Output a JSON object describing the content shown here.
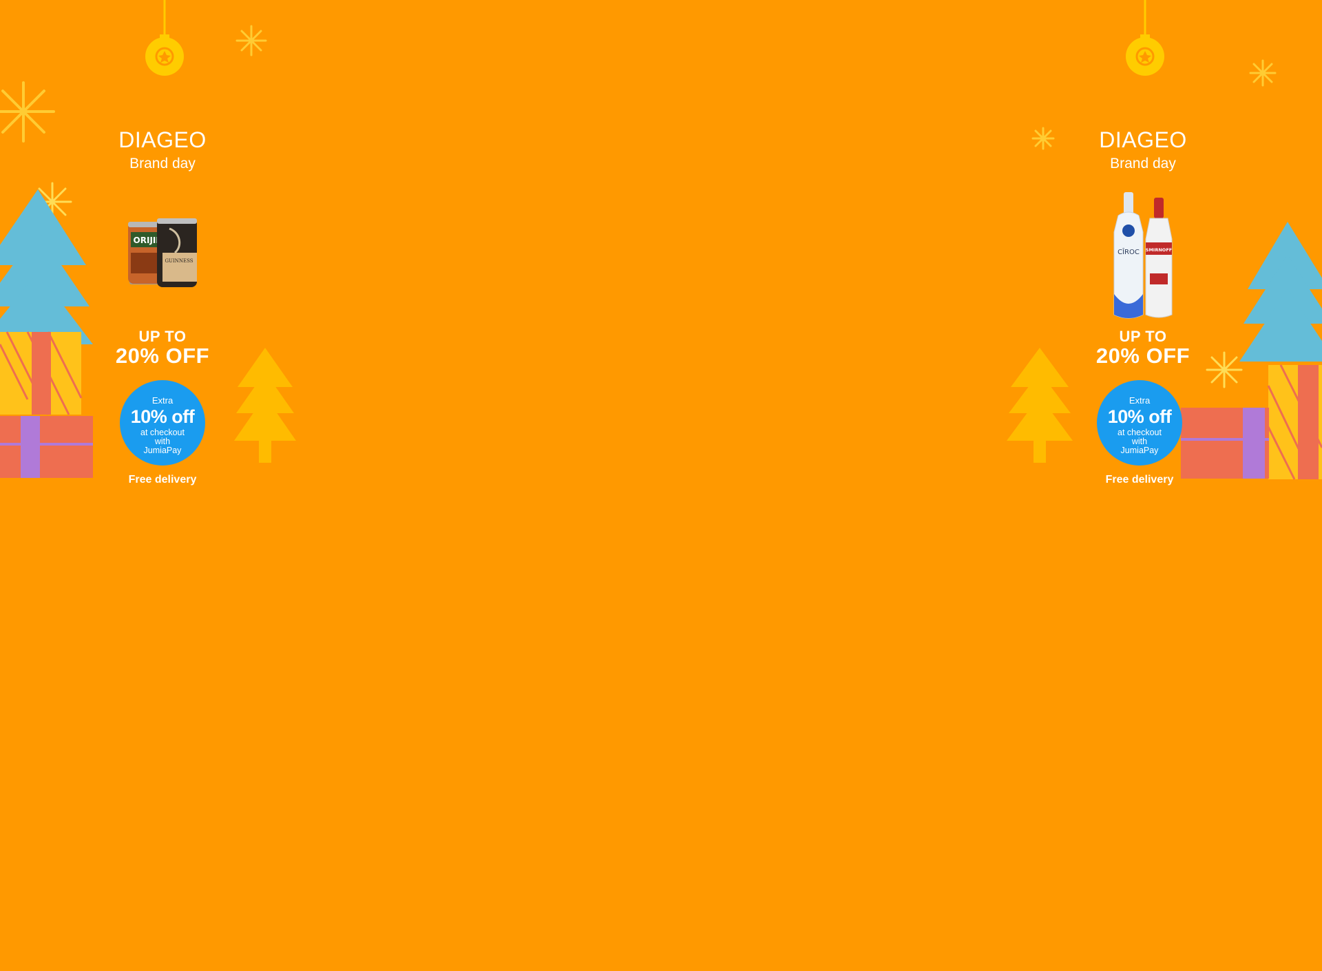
{
  "colors": {
    "background": "#FF9900",
    "badge": "#1a9cef",
    "tree_blue": "#64bdd8",
    "tree_yellow": "#FFBB00",
    "gift_red": "#ee6e50",
    "gift_purple": "#b07ad8"
  },
  "left_panel": {
    "brand": "DIAGEO",
    "subtitle": "Brand day",
    "product_image": "orijin-and-guinness-smooth-cans",
    "product_labels": {
      "can1": "ORIJIN",
      "can2": "GUINNESS"
    },
    "offer_line1": "UP TO",
    "offer_line2": "20% OFF",
    "badge": {
      "line1": "Extra",
      "line2": "10% off",
      "line3": "at checkout",
      "line4": "with",
      "line5": "JumiaPay"
    },
    "delivery": "Free delivery"
  },
  "right_panel": {
    "brand": "DIAGEO",
    "subtitle": "Brand day",
    "product_image": "ciroc-and-smirnoff-bottles",
    "product_labels": {
      "bottle1": "CÎROC",
      "bottle2": "SMIRNOFF"
    },
    "offer_line1": "UP TO",
    "offer_line2": "20% OFF",
    "badge": {
      "line1": "Extra",
      "line2": "10% off",
      "line3": "at checkout",
      "line4": "with",
      "line5": "JumiaPay"
    },
    "delivery": "Free delivery"
  }
}
